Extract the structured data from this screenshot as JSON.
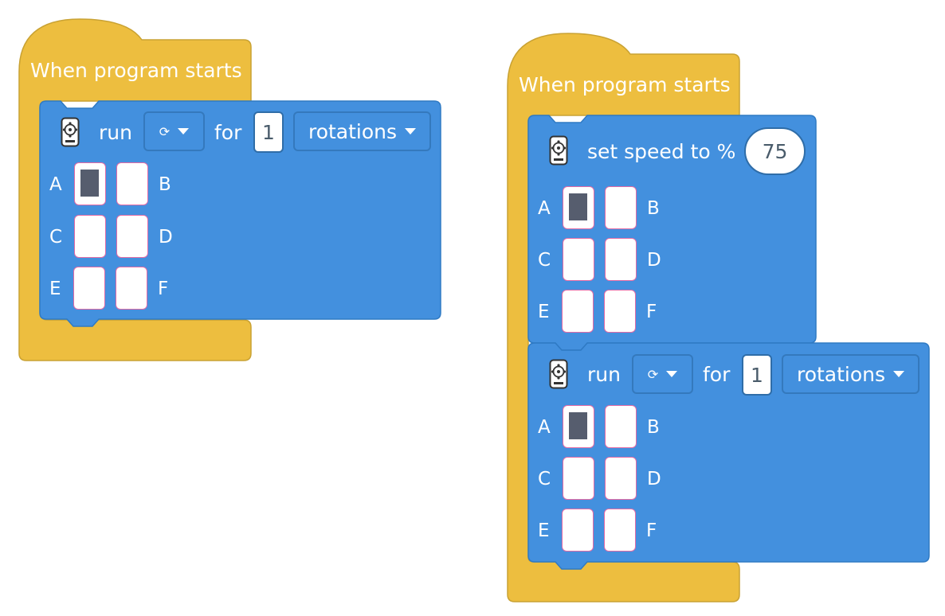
{
  "colors": {
    "hat": "#edbe3f",
    "block": "#4390de",
    "port_selected": "#565d6e",
    "port_border": "#e36aa5"
  },
  "stacks": [
    {
      "hat_label": "When program starts",
      "blocks": [
        {
          "type": "run",
          "icon": "motor-hub-icon",
          "run_label": "run",
          "direction_glyph": "⟳",
          "for_label": "for",
          "amount": "1",
          "unit": "rotations",
          "ports": [
            "A",
            "B",
            "C",
            "D",
            "E",
            "F"
          ],
          "selected_port": "A"
        }
      ]
    },
    {
      "hat_label": "When program starts",
      "blocks": [
        {
          "type": "set_speed",
          "icon": "motor-hub-icon",
          "label": "set speed to %",
          "value": "75",
          "ports": [
            "A",
            "B",
            "C",
            "D",
            "E",
            "F"
          ],
          "selected_port": "A"
        },
        {
          "type": "run",
          "icon": "motor-hub-icon",
          "run_label": "run",
          "direction_glyph": "⟳",
          "for_label": "for",
          "amount": "1",
          "unit": "rotations",
          "ports": [
            "A",
            "B",
            "C",
            "D",
            "E",
            "F"
          ],
          "selected_port": "A"
        }
      ]
    }
  ]
}
